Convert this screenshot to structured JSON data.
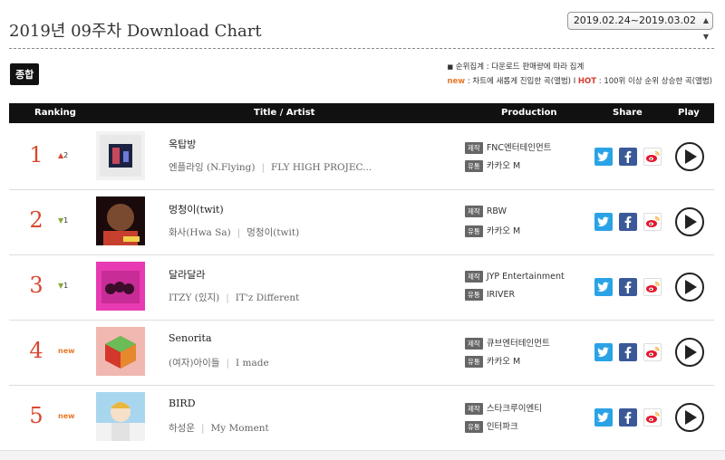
{
  "header": {
    "title": "2019년 09주차 Download Chart",
    "date_range": "2019.02.24~2019.03.02"
  },
  "category_badge": "종합",
  "notes": {
    "line1": "순위집계 : 다운로드 판매량에 따라 집계",
    "new_label": "new",
    "new_desc": " : 차트에 새롭게 진입한 곡(앨범) I ",
    "hot_label": "HOT",
    "hot_desc": " : 100위 이상 순위 상승한 곡(앨범)"
  },
  "columns": {
    "ranking": "Ranking",
    "title_artist": "Title / Artist",
    "production": "Production",
    "share": "Share",
    "play": "Play"
  },
  "production_tags": {
    "maker": "제작",
    "distributor": "유통"
  },
  "rows": [
    {
      "rank": "1",
      "change_dir": "up",
      "change": "2",
      "title": "옥탑방",
      "artist": "엔플라잉 (N.Flying)",
      "album": "FLY HIGH PROJEC...",
      "maker": "FNC엔터테인먼트",
      "distributor": "카카오 M"
    },
    {
      "rank": "2",
      "change_dir": "down",
      "change": "1",
      "title": "멍청이(twit)",
      "artist": "화사(Hwa Sa)",
      "album": "멍청이(twit)",
      "maker": "RBW",
      "distributor": "카카오 M"
    },
    {
      "rank": "3",
      "change_dir": "down",
      "change": "1",
      "title": "달라달라",
      "artist": "ITZY (있지)",
      "album": "IT'z Different",
      "maker": "JYP Entertainment",
      "distributor": "IRIVER"
    },
    {
      "rank": "4",
      "change_dir": "new",
      "change": "new",
      "title": "Senorita",
      "artist": "(여자)아이들",
      "album": "I made",
      "maker": "큐브엔터테인먼트",
      "distributor": "카카오 M"
    },
    {
      "rank": "5",
      "change_dir": "new",
      "change": "new",
      "title": "BIRD",
      "artist": "하성운",
      "album": "My Moment",
      "maker": "스타크루이엔티",
      "distributor": "인터파크"
    }
  ],
  "colors": {
    "rank": "#d9482e",
    "twitter": "#2aa3e6",
    "facebook": "#3b5998",
    "header_bg": "#111111"
  }
}
